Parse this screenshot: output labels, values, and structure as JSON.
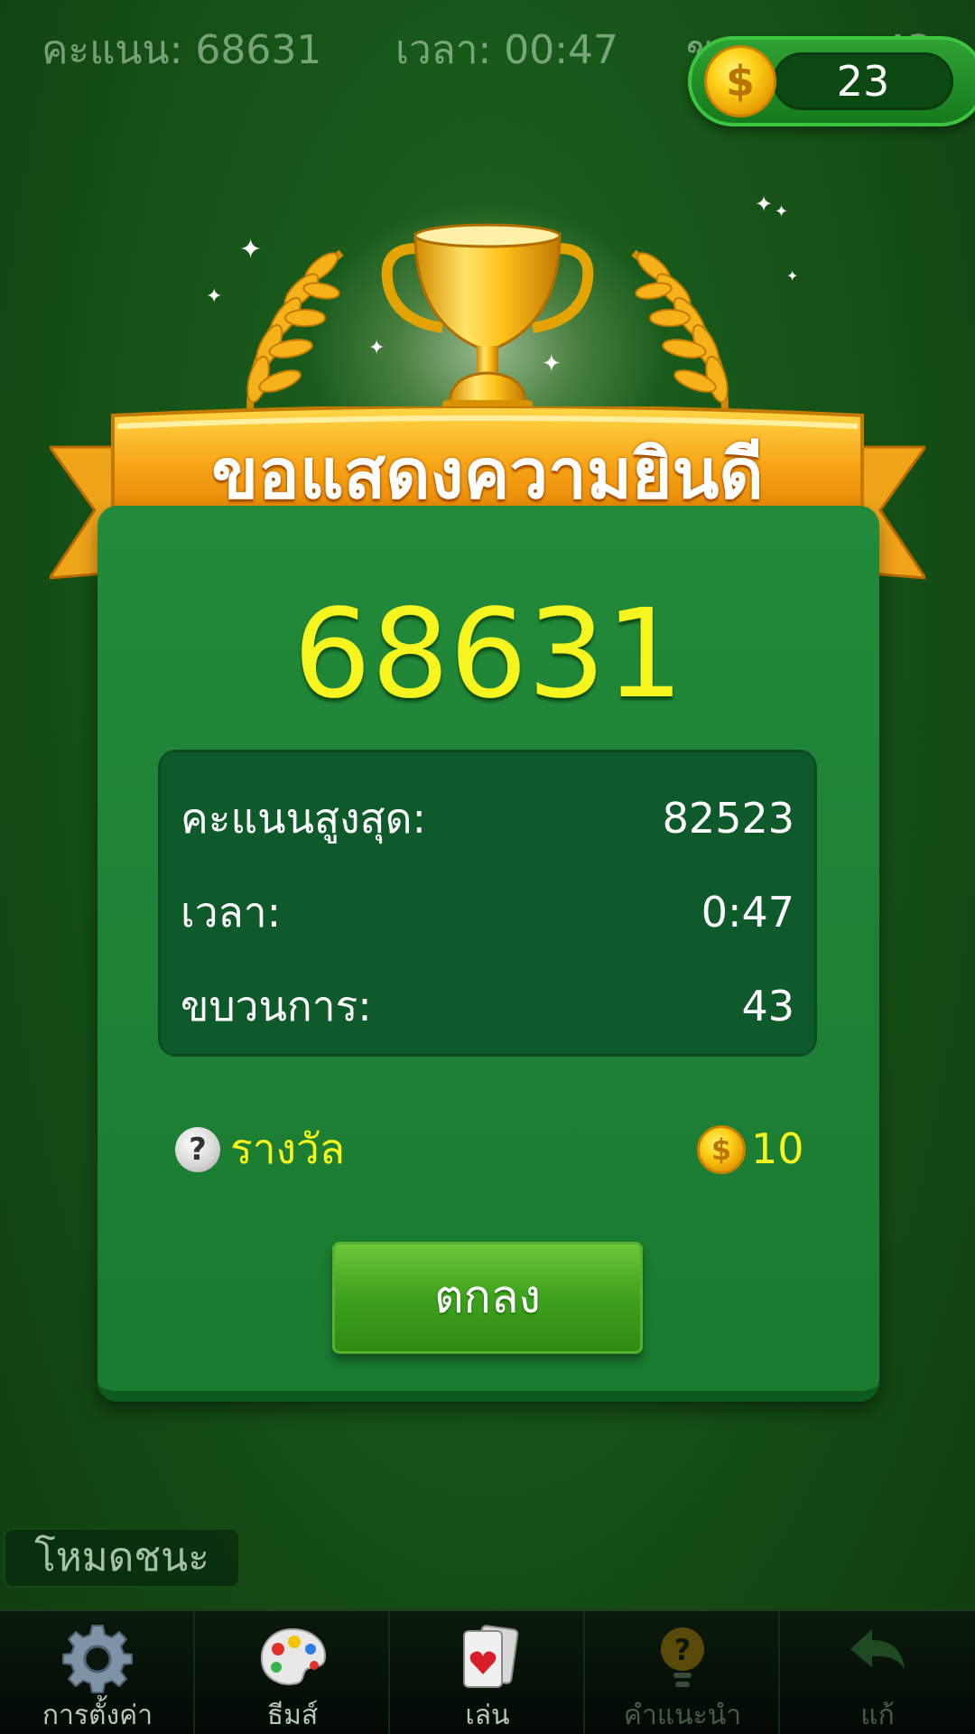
{
  "status_bar": {
    "score_text": "คะแนน: 68631",
    "time_text": "เวลา: 00:47",
    "moves_text": "ขบวนการ: 43"
  },
  "coins": {
    "balance": "23",
    "icon": "dollar-coin-icon"
  },
  "dialog": {
    "title": "ขอแสดงความยินดี",
    "score": "68631",
    "stats": [
      {
        "label": "คะแนนสูงสุด:",
        "value": "82523"
      },
      {
        "label": "เวลา:",
        "value": "0:47"
      },
      {
        "label": "ขบวนการ:",
        "value": "43"
      }
    ],
    "reward_label": "รางวัล",
    "reward_value": "10",
    "ok_label": "ตกลง"
  },
  "win_mode_label": "โหมดชนะ",
  "bottom_nav": [
    {
      "label": "การตั้งค่า",
      "icon": "gear-icon"
    },
    {
      "label": "ธีมส์",
      "icon": "palette-icon"
    },
    {
      "label": "เล่น",
      "icon": "cards-icon"
    },
    {
      "label": "คำแนะนำ",
      "icon": "hint-bulb-icon"
    },
    {
      "label": "แก้",
      "icon": "undo-arrow-icon"
    }
  ],
  "colors": {
    "background": "#175418",
    "panel": "#228a3a",
    "score_yellow": "#f7f520",
    "ribbon_orange": "#f59a12",
    "button_green": "#3ea11d"
  }
}
